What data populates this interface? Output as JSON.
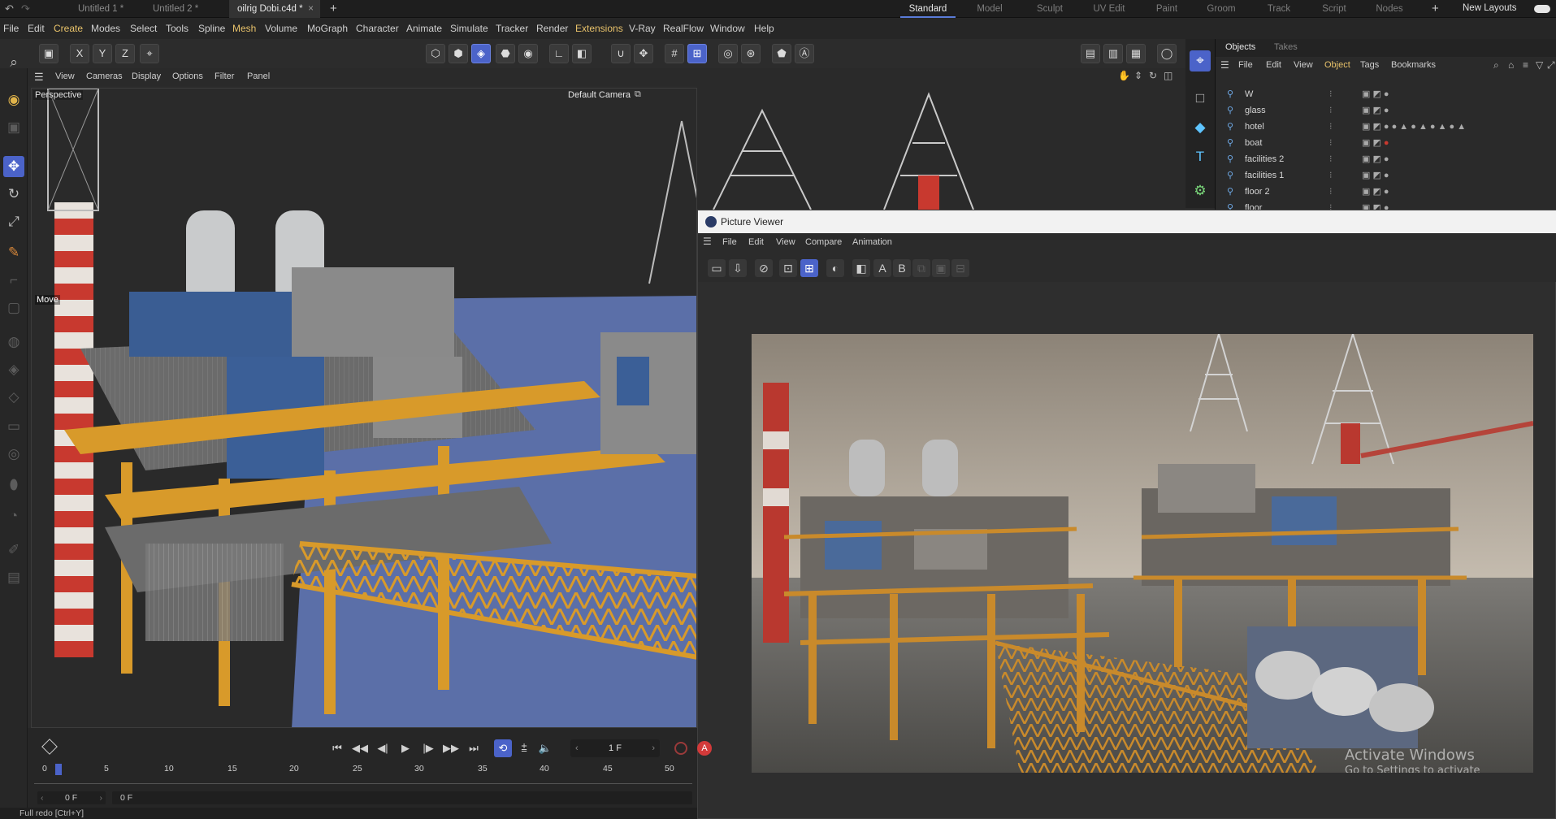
{
  "tabs": {
    "doc1": "Untitled 1 *",
    "doc2": "Untitled 2 *",
    "doc3": "oilrig Dobi.c4d *",
    "add": "+",
    "close": "×"
  },
  "layouts": {
    "items": [
      "Standard",
      "Model",
      "Sculpt",
      "UV Edit",
      "Paint",
      "Groom",
      "Track",
      "Script",
      "Nodes"
    ],
    "active": "Standard",
    "new_layouts": "New Layouts",
    "add": "+"
  },
  "menu": [
    "File",
    "Edit",
    "Create",
    "Modes",
    "Select",
    "Tools",
    "Spline",
    "Mesh",
    "Volume",
    "MoGraph",
    "Character",
    "Animate",
    "Simulate",
    "Tracker",
    "Render",
    "Extensions",
    "V-Ray",
    "RealFlow",
    "Window",
    "Help"
  ],
  "toolbar": {
    "axis_x": "X",
    "axis_y": "Y",
    "axis_z": "Z"
  },
  "viewport": {
    "menu": [
      "View",
      "Cameras",
      "Display",
      "Options",
      "Filter",
      "Panel"
    ],
    "label": "Perspective",
    "camera": "Default Camera",
    "tooltip": "Move"
  },
  "objects_panel": {
    "tabs": [
      "Objects",
      "Takes"
    ],
    "menu": [
      "File",
      "Edit",
      "View",
      "Object",
      "Tags",
      "Bookmarks"
    ],
    "active_menu": "Object",
    "rows": [
      "W",
      "glass",
      "hotel",
      "boat",
      "facilities 2",
      "facilities 1",
      "floor 2",
      "floor"
    ]
  },
  "picture_viewer": {
    "title": "Picture Viewer",
    "menu": [
      "File",
      "Edit",
      "View",
      "Compare",
      "Animation"
    ],
    "ab_a": "A",
    "ab_b": "B"
  },
  "timeline": {
    "ticks": [
      "0",
      "5",
      "10",
      "15",
      "20",
      "25",
      "30",
      "35",
      "40",
      "45",
      "50"
    ],
    "current_frame": "1 F",
    "start_field": "0 F",
    "end_field": "0 F",
    "rec_label": "A"
  },
  "status": "Full redo [Ctrl+Y]",
  "watermark": {
    "line1": "Activate Windows",
    "line2": "Go to Settings to activate Windows."
  },
  "colors": {
    "accent": "#4b63c9",
    "highlight_menu": "#e8c26a",
    "viewport_sky": "#5b6fa8",
    "steel_orange": "#d89a2a"
  }
}
